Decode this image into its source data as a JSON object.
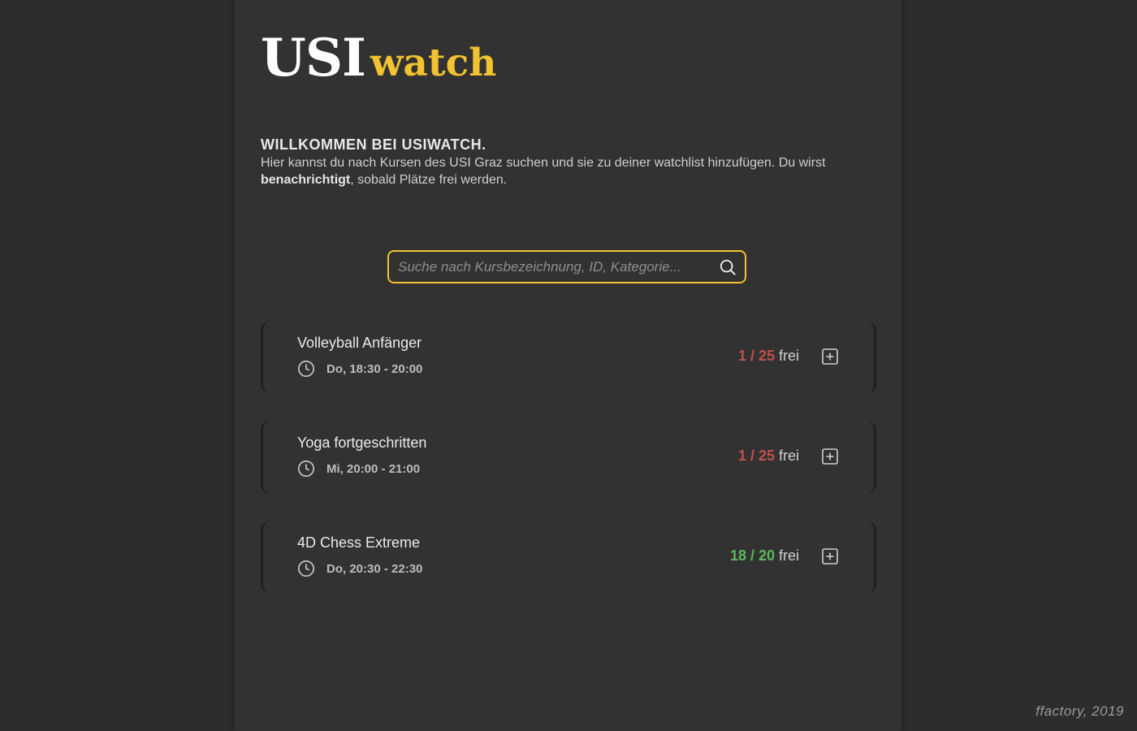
{
  "logo": {
    "main": "USI",
    "sub": "watch"
  },
  "welcome": {
    "title": "WILLKOMMEN BEI USIWATCH.",
    "text_before": "Hier kannst du nach Kursen des USI Graz suchen und sie zu deiner watchlist hinzufügen. Du wirst ",
    "text_bold": "benachrichtigt",
    "text_after": ", sobald Plätze frei werden."
  },
  "search": {
    "placeholder": "Suche nach Kursbezeichnung, ID, Kategorie...",
    "value": "",
    "icon": "search-icon"
  },
  "courses": [
    {
      "name": "Volleyball Anfänger",
      "time": "Do, 18:30 - 20:00",
      "free": "1 / 25",
      "free_label": "frei",
      "status_color": "#c0504d"
    },
    {
      "name": "Yoga fortgeschritten",
      "time": "Mi, 20:00 - 21:00",
      "free": "1 / 25",
      "free_label": "frei",
      "status_color": "#c0504d"
    },
    {
      "name": "4D Chess Extreme",
      "time": "Do, 20:30 - 22:30",
      "free": "18 / 20",
      "free_label": "frei",
      "status_color": "#5cb85c"
    }
  ],
  "colors": {
    "accent": "#f2c230",
    "low_availability": "#c0504d",
    "high_availability": "#5cb85c"
  },
  "footer": "ffactory, 2019"
}
